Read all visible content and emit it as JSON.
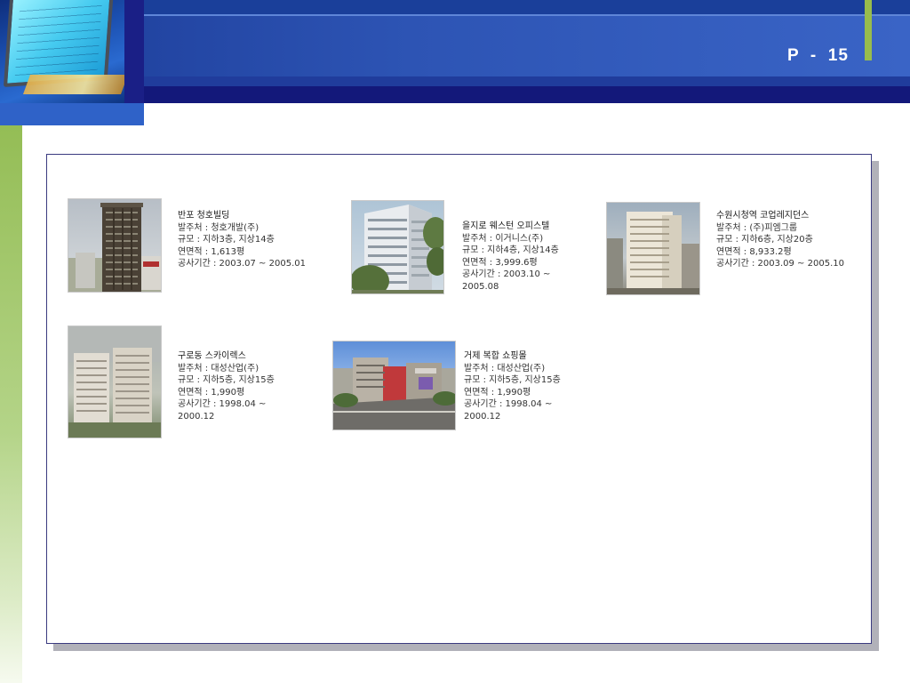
{
  "header": {
    "page_label": "P  -  15"
  },
  "projects": [
    {
      "name": "반포 청호빌딩",
      "client": "발주처 : 청호개발(주)",
      "scale": "규모 : 지하3층, 지상14층",
      "area": "연면적 : 1,613평",
      "period": "공사기간 : 2003.07 ~ 2005.01"
    },
    {
      "name": "을지로 웨스턴 오피스텔",
      "client": "발주처 : 이거니스(주)",
      "scale": "규모 : 지하4층, 지상14층",
      "area": "연면적 : 3,999.6평",
      "period": "공사기간 : 2003.10 ~ 2005.08"
    },
    {
      "name": "수원시청역 코업레지던스",
      "client": "발주처 : (주)피엠그룹",
      "scale": "규모 : 지하6층, 지상20층",
      "area": "연면적 : 8,933.2평",
      "period": "공사기간 : 2003.09 ~ 2005.10"
    },
    {
      "name": "구로동 스카이렉스",
      "client": "발주처 : 대성산업(주)",
      "scale": "규모 : 지하5층, 지상15층",
      "area": "연면적 : 1,990평",
      "period": "공사기간 : 1998.04 ~ 2000.12"
    },
    {
      "name": "거제 복합 쇼핑몰",
      "client": "발주처 : 대성산업(주)",
      "scale": "규모 : 지하5층, 지상15층",
      "area": "연면적 : 1,990평",
      "period": "공사기간 : 1998.04 ~ 2000.12"
    }
  ]
}
